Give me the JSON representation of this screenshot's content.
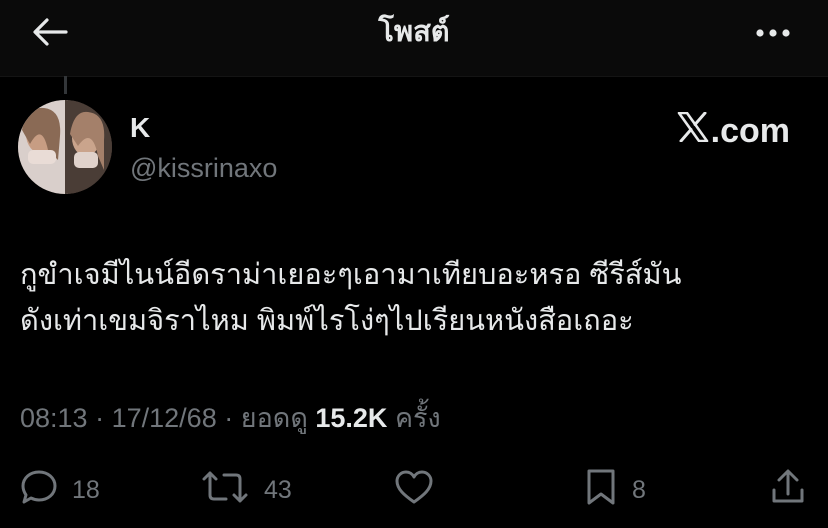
{
  "header": {
    "title": "โพสต์",
    "back_icon": "arrow-left-icon",
    "more_icon": "more-horizontal-icon"
  },
  "author": {
    "display_name": "K",
    "handle": "@kissrinaxo"
  },
  "brand": {
    "logo_icon": "x-logo-icon",
    "label": ".com"
  },
  "post": {
    "text_line1": "กูขำเจมีไนน์อีดราม่าเยอะๆเอามาเทียบอะหรอ ซีรีส์มัน",
    "text_line2": "ดังเท่าเขมจิราไหม พิมพ์ไรโง่ๆไปเรียนหนังสือเถอะ"
  },
  "meta": {
    "time": "08:13",
    "date": "17/12/68",
    "views_label": "ยอดดู",
    "views_count": "15.2K",
    "views_suffix": "ครั้ง",
    "separator": "·"
  },
  "actions": {
    "replies": "18",
    "reposts": "43",
    "bookmarks": "8"
  },
  "colors": {
    "background": "#000000",
    "text": "#e7e9ea",
    "muted": "#71767b"
  }
}
